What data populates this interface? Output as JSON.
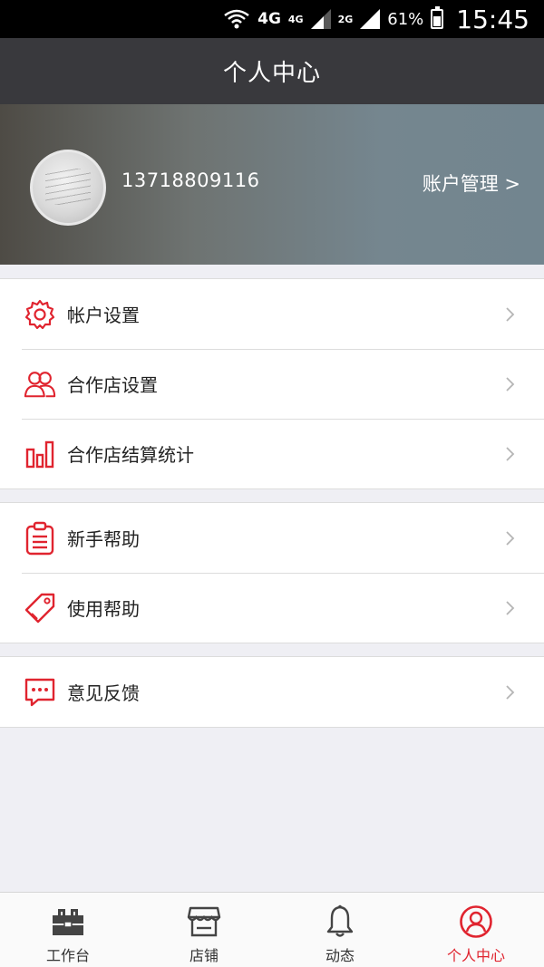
{
  "status_bar": {
    "net1": "4G",
    "net2": "4G",
    "net3": "2G",
    "battery": "61%",
    "battery_level": 0.61,
    "time": "15:45"
  },
  "nav": {
    "title": "个人中心"
  },
  "profile": {
    "phone": "13718809116",
    "account_manage": "账户管理 >"
  },
  "groups": [
    {
      "items": [
        {
          "label": "帐户设置",
          "icon": "gear-icon"
        },
        {
          "label": "合作店设置",
          "icon": "users-icon"
        },
        {
          "label": "合作店结算统计",
          "icon": "bar-chart-icon"
        }
      ]
    },
    {
      "items": [
        {
          "label": "新手帮助",
          "icon": "clipboard-icon"
        },
        {
          "label": "使用帮助",
          "icon": "tag-icon"
        }
      ]
    },
    {
      "items": [
        {
          "label": "意见反馈",
          "icon": "chat-icon"
        }
      ]
    }
  ],
  "tabbar": {
    "tabs": [
      {
        "label": "工作台",
        "icon": "toolbox-icon",
        "active": false
      },
      {
        "label": "店铺",
        "icon": "store-icon",
        "active": false
      },
      {
        "label": "动态",
        "icon": "bell-icon",
        "active": false
      },
      {
        "label": "个人中心",
        "icon": "user-icon",
        "active": true
      }
    ]
  },
  "colors": {
    "accent": "#e0242f",
    "nav_bg": "#39393d",
    "page_bg": "#efeff4"
  }
}
